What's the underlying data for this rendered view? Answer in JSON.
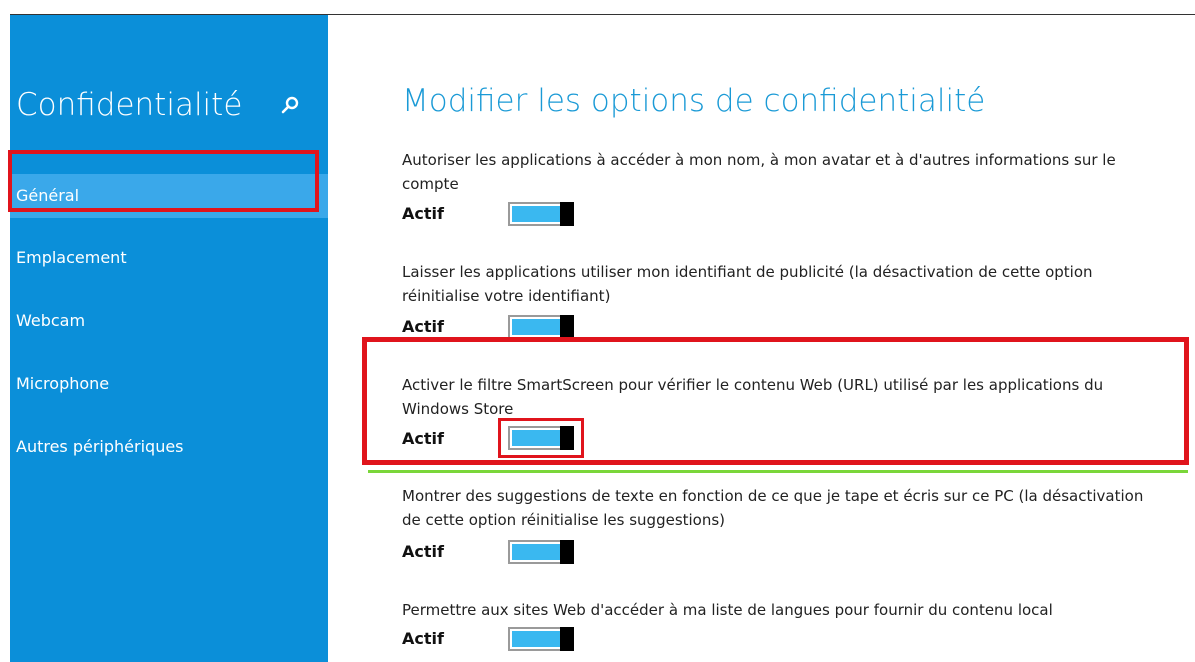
{
  "sidebar": {
    "title": "Confidentialité",
    "search_icon": "search-icon",
    "items": [
      {
        "label": "Général",
        "selected": true
      },
      {
        "label": "Emplacement",
        "selected": false
      },
      {
        "label": "Webcam",
        "selected": false
      },
      {
        "label": "Microphone",
        "selected": false
      },
      {
        "label": "Autres périphériques",
        "selected": false
      }
    ]
  },
  "main": {
    "title": "Modifier les options de confidentialité",
    "settings": [
      {
        "description": "Autoriser les applications à accéder à mon nom, à mon avatar et à d'autres informations sur le compte",
        "state": "Actif",
        "on": true
      },
      {
        "description": "Laisser les applications utiliser mon identifiant de publicité (la désactivation de cette option réinitialise votre identifiant)",
        "state": "Actif",
        "on": true
      },
      {
        "description": "Activer le filtre SmartScreen pour vérifier le contenu Web (URL) utilisé par les applications du Windows Store",
        "state": "Actif",
        "on": true
      },
      {
        "description": "Montrer des suggestions de texte en fonction de ce que je tape et écris sur ce PC (la désactivation de cette option réinitialise les suggestions)",
        "state": "Actif",
        "on": true
      },
      {
        "description": "Permettre aux sites Web d'accéder à ma liste de langues pour fournir du contenu local",
        "state": "Actif",
        "on": true
      }
    ]
  },
  "colors": {
    "sidebar_bg": "#0b8fd9",
    "sidebar_selected": "#3aa8ea",
    "title_blue": "#1a9ad6",
    "toggle_fill": "#3ab8f0",
    "highlight_red": "#e0141c",
    "highlight_green": "#7ad63a"
  }
}
